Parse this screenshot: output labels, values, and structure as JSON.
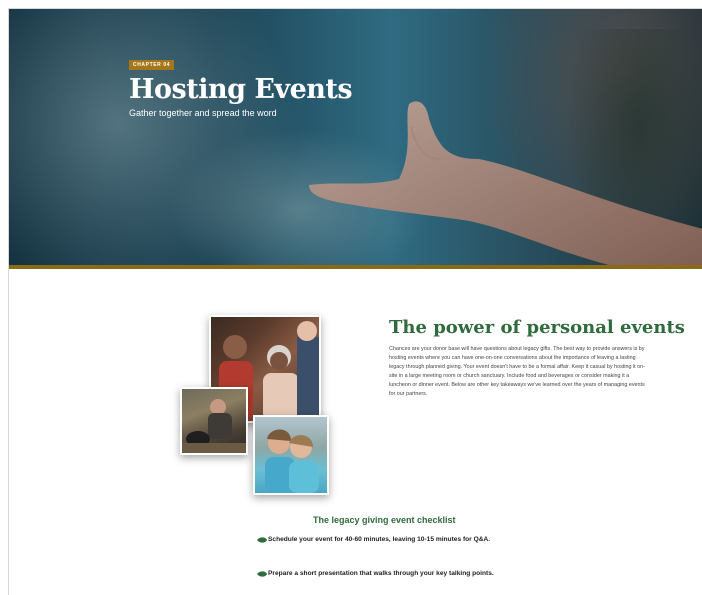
{
  "hero": {
    "chapter_label": "CHAPTER 04",
    "title": "Hosting Events",
    "subtitle": "Gather together and spread the word"
  },
  "section": {
    "title": "The power of personal events",
    "body": "Chances are your donor base will have questions about legacy gifts. The best way to provide answers is by hosting events where you can have one-on-one conversations about the importance of leaving a lasting legacy through planned giving. Your event doesn't have to be a formal affair. Keep it casual by hosting it on-site in a large meeting room or church sanctuary. Include food and beverages or consider making it a luncheon or dinner event. Below are other key takeaways we've learned over the years of managing events for our partners."
  },
  "checklist": {
    "title": "The legacy giving event checklist",
    "items": [
      "Schedule your event for 40-60 minutes, leaving 10-15 minutes for Q&A.",
      "Prepare a short presentation that walks through your key talking points."
    ]
  },
  "colors": {
    "accent_green": "#2f6b3c",
    "gold": "#a5771a",
    "hero_teal": "#1d4556"
  }
}
